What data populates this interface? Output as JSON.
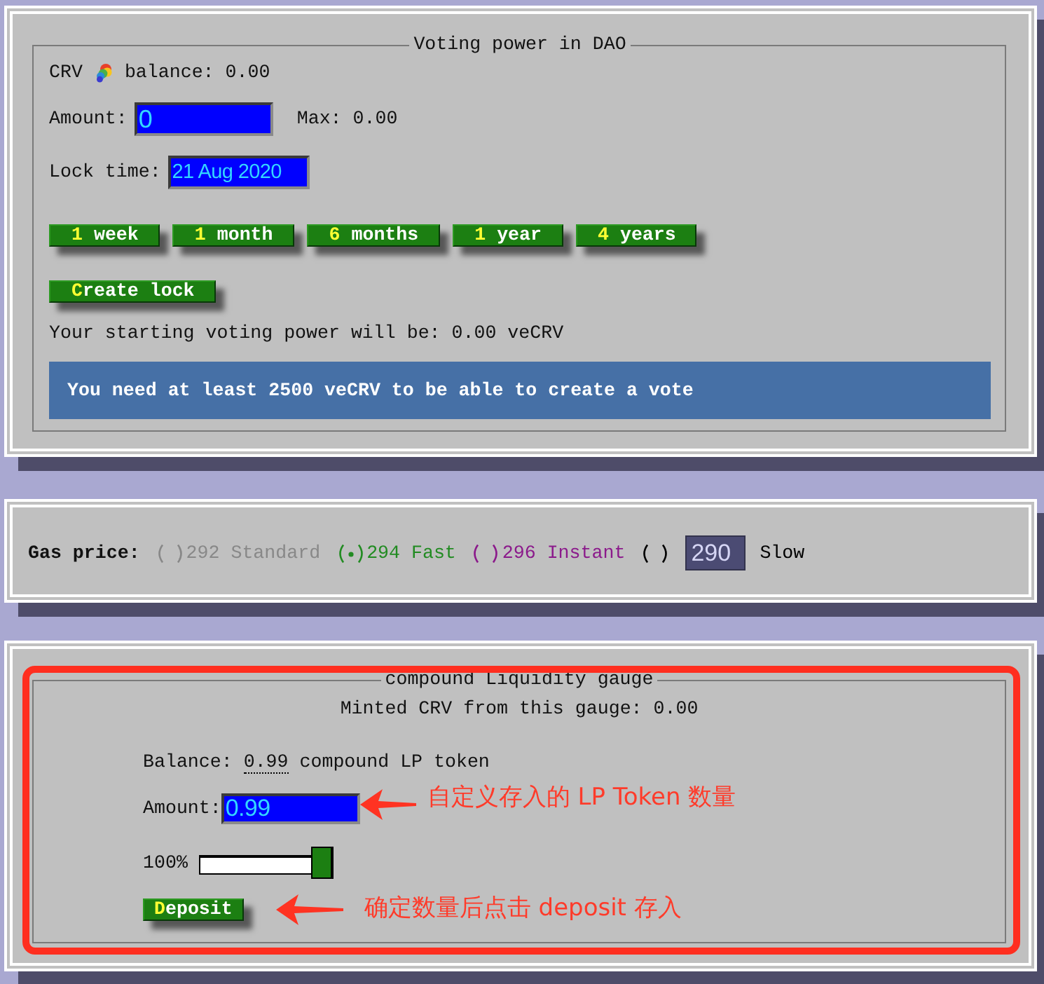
{
  "dao_panel": {
    "title": "Voting power in DAO",
    "balance": {
      "token": "CRV",
      "text": "balance: 0.00"
    },
    "amount": {
      "label": "Amount:",
      "value": "0",
      "max": "Max: 0.00"
    },
    "lock_time": {
      "label": "Lock time:",
      "value": "21 Aug 2020"
    },
    "duration_buttons": [
      {
        "label": "1 week"
      },
      {
        "label": "1 month"
      },
      {
        "label": "6 months"
      },
      {
        "label": "1 year"
      },
      {
        "label": "4 years"
      }
    ],
    "create_button": {
      "label": "Create lock"
    },
    "voting_power_text": "Your starting voting power will be: 0.00 veCRV",
    "notice": "You need at least 2500 veCRV to be able to create a vote"
  },
  "gas_panel": {
    "label": "Gas price:",
    "options": [
      {
        "kind": "preset",
        "label": "292 Standard",
        "color": "#888888",
        "selected": false
      },
      {
        "kind": "preset",
        "label": "294 Fast",
        "color": "#228b22",
        "selected": true
      },
      {
        "kind": "preset",
        "label": "296 Instant",
        "color": "#8b1a8b",
        "selected": false
      },
      {
        "kind": "custom",
        "value": "290",
        "label": "Slow",
        "color": "#000000",
        "selected": false
      }
    ]
  },
  "gauge_panel": {
    "title": "compound Liquidity gauge",
    "highlighted": true,
    "minted": "Minted CRV from this gauge: 0.00",
    "balance": {
      "label": "Balance:",
      "value": "0.99",
      "unit": "compound LP token"
    },
    "amount": {
      "label": "Amount:",
      "value": "0.99",
      "note": "自定义存入的 LP Token 数量"
    },
    "slider": {
      "label": "100%",
      "level": 1
    },
    "deposit_button": {
      "label": "Deposit",
      "note": "确定数量后点击 deposit 存入"
    }
  }
}
